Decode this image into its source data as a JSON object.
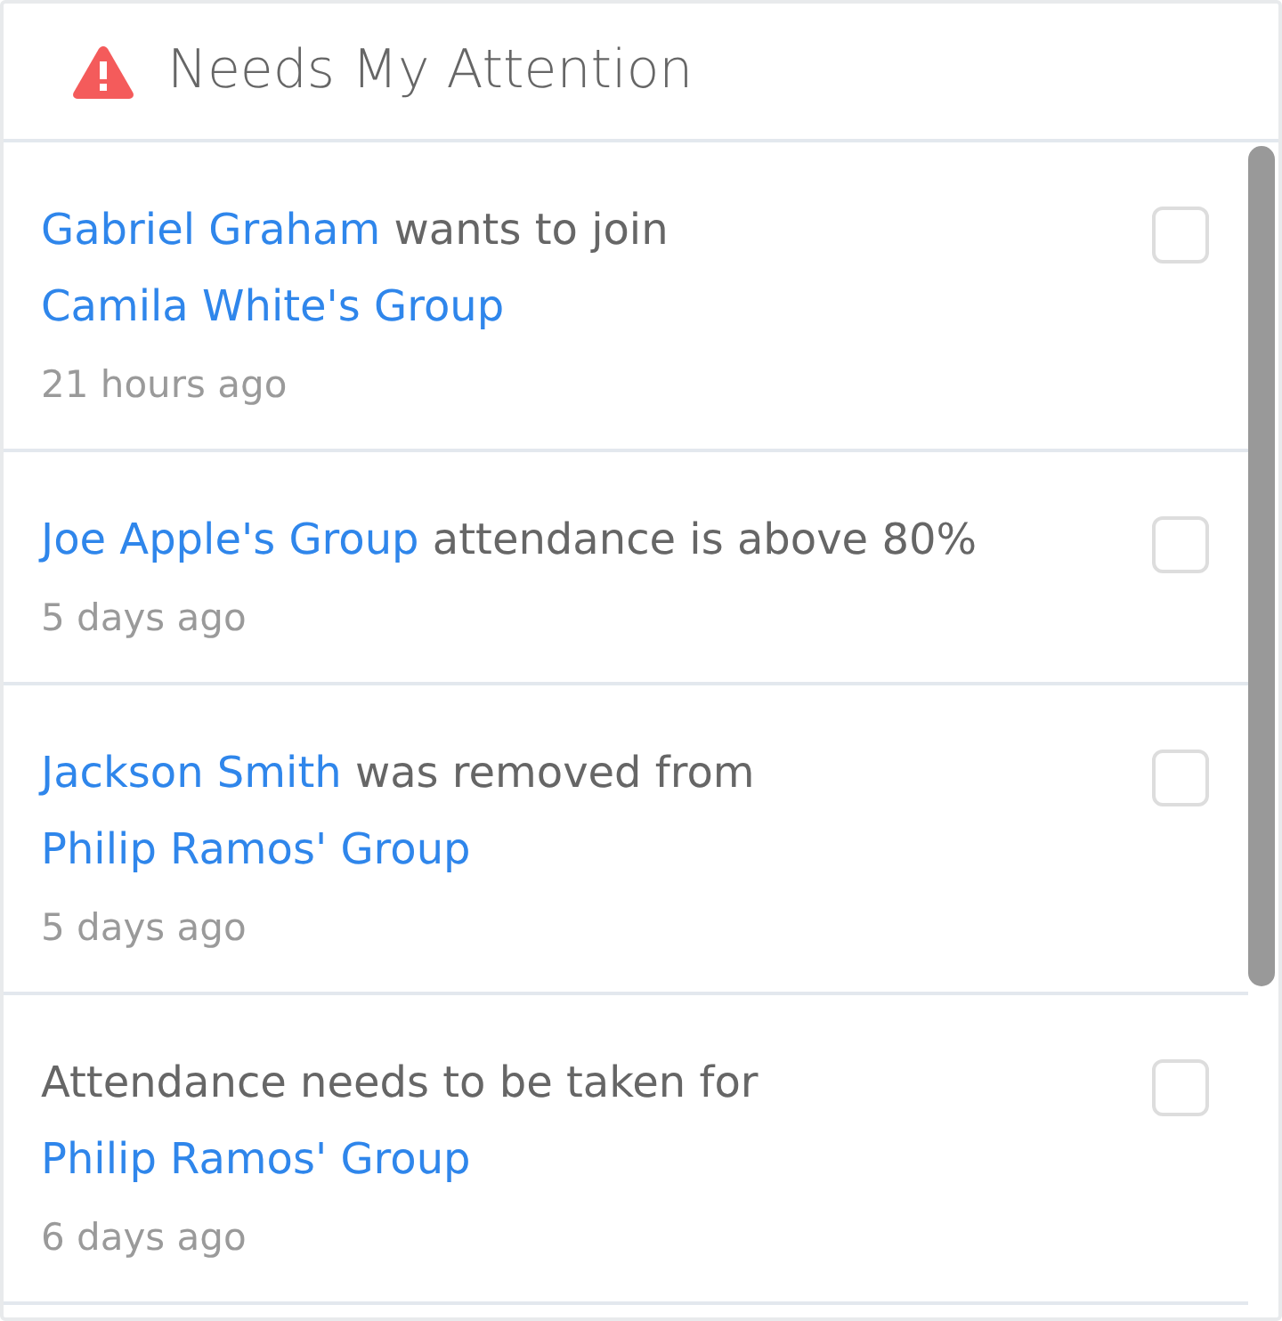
{
  "panel": {
    "title": "Needs My Attention"
  },
  "items": [
    {
      "message": [
        {
          "kind": "link",
          "text": "Gabriel Graham"
        },
        {
          "kind": "text",
          "text": "wants to join"
        },
        {
          "kind": "link",
          "text": "Camila White's Group"
        }
      ],
      "time": "21 hours ago",
      "checked": false
    },
    {
      "message": [
        {
          "kind": "link",
          "text": "Joe Apple's Group"
        },
        {
          "kind": "text",
          "text": "attendance is above 80%"
        }
      ],
      "time": "5 days ago",
      "checked": false
    },
    {
      "message": [
        {
          "kind": "link",
          "text": "Jackson Smith"
        },
        {
          "kind": "text",
          "text": "was removed from"
        },
        {
          "kind": "link",
          "text": "Philip Ramos' Group"
        }
      ],
      "time": "5 days ago",
      "checked": false
    },
    {
      "message": [
        {
          "kind": "text",
          "text": "Attendance needs to be taken for"
        },
        {
          "kind": "link",
          "text": "Philip Ramos' Group"
        }
      ],
      "time": "6 days ago",
      "checked": false
    }
  ]
}
